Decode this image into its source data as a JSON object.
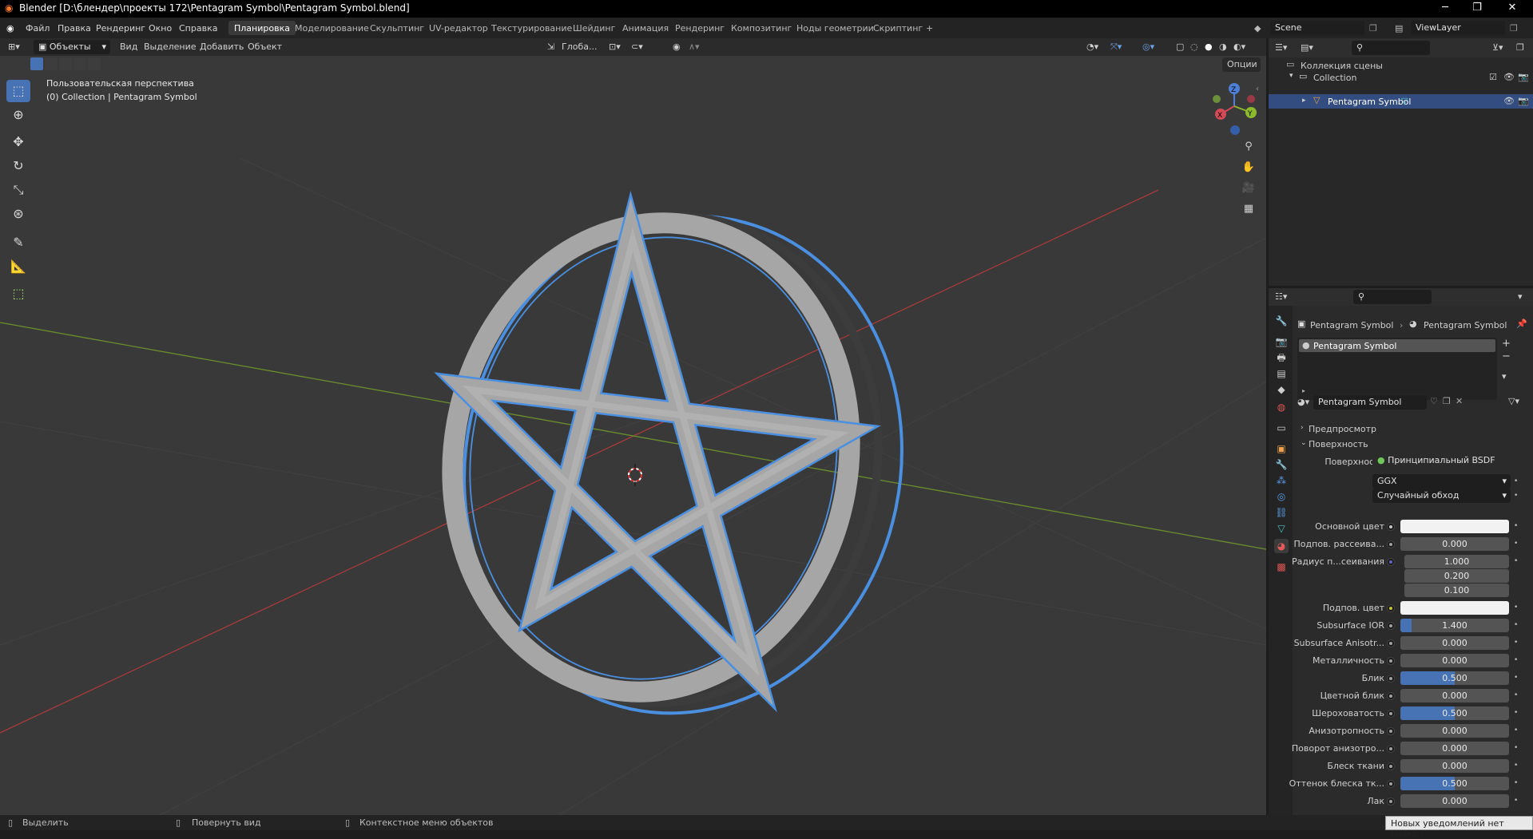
{
  "window": {
    "title": "Blender [D:\\блендер\\проекты 172\\Pentagram Symbol\\Pentagram Symbol.blend]",
    "minimize_icon": "minimize-icon",
    "maximize_icon": "restore-icon",
    "close_icon": "close-icon"
  },
  "menu": {
    "items": [
      "Файл",
      "Правка",
      "Рендеринг",
      "Окно",
      "Справка"
    ]
  },
  "workspaces": {
    "tabs": [
      "Планировка",
      "Моделирование",
      "Скульптинг",
      "UV-редактор",
      "Текстурирование",
      "Шейдинг",
      "Анимация",
      "Рендеринг",
      "Композитинг",
      "Ноды геометрии",
      "Скриптинг"
    ],
    "active": "Планировка",
    "add": "+"
  },
  "scene": {
    "name": "Scene",
    "view_layer": "ViewLayer"
  },
  "viewport": {
    "mode": "Объекты",
    "menus": [
      "Вид",
      "Выделение",
      "Добавить",
      "Объект"
    ],
    "transform_orientation": "Глоба...",
    "options": "Опции",
    "perspective_label": "Пользовательская перспектива",
    "collection_label": "(0) Collection | Pentagram Symbol",
    "gizmo": {
      "x": "X",
      "y": "Y",
      "z": "Z"
    },
    "tools": [
      "select-box-icon",
      "cursor-icon",
      "move-icon",
      "rotate-icon",
      "scale-icon",
      "transform-icon",
      "annotate-icon",
      "measure-icon",
      "add-cube-icon"
    ],
    "nav": [
      "zoom-icon",
      "hand-icon",
      "camera-icon",
      "grid-icon"
    ]
  },
  "outliner": {
    "search_placeholder": "",
    "scene_collection": "Коллекция сцены",
    "collection": "Collection",
    "object": "Pentagram Symbol"
  },
  "properties": {
    "breadcrumb_object": "Pentagram Symbol",
    "breadcrumb_material": "Pentagram Symbol",
    "material_slot": "Pentagram Symbol",
    "material_name": "Pentagram Symbol",
    "sections": {
      "preview": "Предпросмотр",
      "surface": "Поверхность"
    },
    "surface_label": "Поверхность",
    "surface_value": "Принципиальный BSDF",
    "distribution": "GGX",
    "subsurface_method": "Случайный обход",
    "fields": [
      {
        "label": "Основной цвет",
        "type": "color",
        "color": "#f2f2f2",
        "dot": "#c6c6c6"
      },
      {
        "label": "Подпов. рассеива...",
        "type": "value",
        "value": "0.000",
        "fill": 0
      },
      {
        "label": "Радиус п...сеивания",
        "type": "vector",
        "values": [
          "1.000",
          "0.200",
          "0.100"
        ],
        "dot": "#6363c7"
      },
      {
        "label": "Подпов. цвет",
        "type": "color",
        "color": "#f2f2f2",
        "dot": "#c7c729"
      },
      {
        "label": "Subsurface IOR",
        "type": "value",
        "value": "1.400",
        "fill": 0.1
      },
      {
        "label": "Subsurface Anisotr...",
        "type": "value",
        "value": "0.000",
        "fill": 0
      },
      {
        "label": "Металличность",
        "type": "value",
        "value": "0.000",
        "fill": 0
      },
      {
        "label": "Блик",
        "type": "value",
        "value": "0.500",
        "fill": 0.5
      },
      {
        "label": "Цветной блик",
        "type": "value",
        "value": "0.000",
        "fill": 0
      },
      {
        "label": "Шероховатость",
        "type": "value",
        "value": "0.500",
        "fill": 0.5
      },
      {
        "label": "Анизотропность",
        "type": "value",
        "value": "0.000",
        "fill": 0
      },
      {
        "label": "Поворот анизотро...",
        "type": "value",
        "value": "0.000",
        "fill": 0
      },
      {
        "label": "Блеск ткани",
        "type": "value",
        "value": "0.000",
        "fill": 0
      },
      {
        "label": "Оттенок блеска тк...",
        "type": "value",
        "value": "0.500",
        "fill": 0.5
      },
      {
        "label": "Лак",
        "type": "value",
        "value": "0.000",
        "fill": 0
      }
    ],
    "tabs": [
      "tool-icon",
      "render-icon",
      "output-icon",
      "view-layer-icon",
      "scene-icon",
      "world-icon",
      "collection-icon",
      "object-icon",
      "modifier-icon",
      "particles-icon",
      "physics-icon",
      "constraints-icon",
      "data-icon",
      "material-icon",
      "texture-icon"
    ]
  },
  "statusbar": {
    "select": "Выделить",
    "rotate": "Повернуть вид",
    "context": "Контекстное меню объектов",
    "notice": "Новых уведомлений нет (выкл.)"
  },
  "colors": {
    "accent": "#4772b3",
    "selection_outline": "#4a8fe0",
    "x_axis": "#a83a3a",
    "y_axis": "#6b8f2c",
    "active_row": "#334d80"
  }
}
